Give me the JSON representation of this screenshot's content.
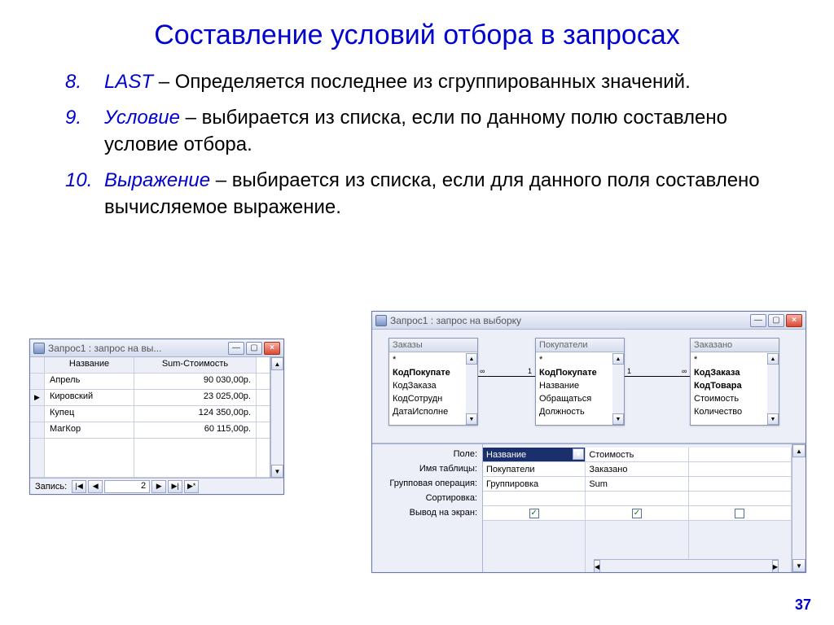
{
  "title": "Составление условий отбора в запросах",
  "page_number": "37",
  "points": [
    {
      "term": "LAST",
      "text": " –  Определяется последнее из сгруппированных значений."
    },
    {
      "term": "Условие",
      "text": " – выбирается из списка, если по данному полю составлено условие отбора."
    },
    {
      "term": "Выражение",
      "text": "  – выбирается из списка, если для данного поля составлено вычисляемое выражение."
    }
  ],
  "datasheet": {
    "title": "Запрос1 : запрос на вы...",
    "columns": [
      "Название",
      "Sum-Стоимость"
    ],
    "rows": [
      {
        "mark": "",
        "c1": "Апрель",
        "c2": "90 030,00р."
      },
      {
        "mark": "▶",
        "c1": "Кировский",
        "c2": "23 025,00р."
      },
      {
        "mark": "",
        "c1": "Купец",
        "c2": "124 350,00р."
      },
      {
        "mark": "",
        "c1": "МагКор",
        "c2": "60 115,00р."
      }
    ],
    "recnav": {
      "label": "Запись:",
      "value": "2"
    }
  },
  "design": {
    "title": "Запрос1 : запрос на выборку",
    "tables": {
      "zakazy": {
        "name": "Заказы",
        "fields": [
          "*",
          "КодПокупате",
          "КодЗаказа",
          "КодСотрудн",
          "ДатаИсполне"
        ],
        "bold": [
          1
        ]
      },
      "pokupateli": {
        "name": "Покупатели",
        "fields": [
          "*",
          "КодПокупате",
          "Название",
          "Обращаться",
          "Должность"
        ],
        "bold": [
          1
        ]
      },
      "zakazano": {
        "name": "Заказано",
        "fields": [
          "*",
          "КодЗаказа",
          "КодТовара",
          "Стоимость",
          "Количество"
        ],
        "bold": [
          1,
          2
        ]
      }
    },
    "joins": [
      {
        "left_label": "∞",
        "right_label": "1"
      },
      {
        "left_label": "1",
        "right_label": "∞"
      }
    ],
    "grid_labels": [
      "Поле:",
      "Имя таблицы:",
      "Групповая операция:",
      "Сортировка:",
      "Вывод на экран:"
    ],
    "grid_cols": [
      {
        "field": "Название",
        "field_selected": true,
        "table": "Покупатели",
        "op": "Группировка",
        "sort": "",
        "show": true
      },
      {
        "field": "Стоимость",
        "field_selected": false,
        "table": "Заказано",
        "op": "Sum",
        "sort": "",
        "show": true
      },
      {
        "field": "",
        "table": "",
        "op": "",
        "sort": "",
        "show": false
      }
    ]
  }
}
